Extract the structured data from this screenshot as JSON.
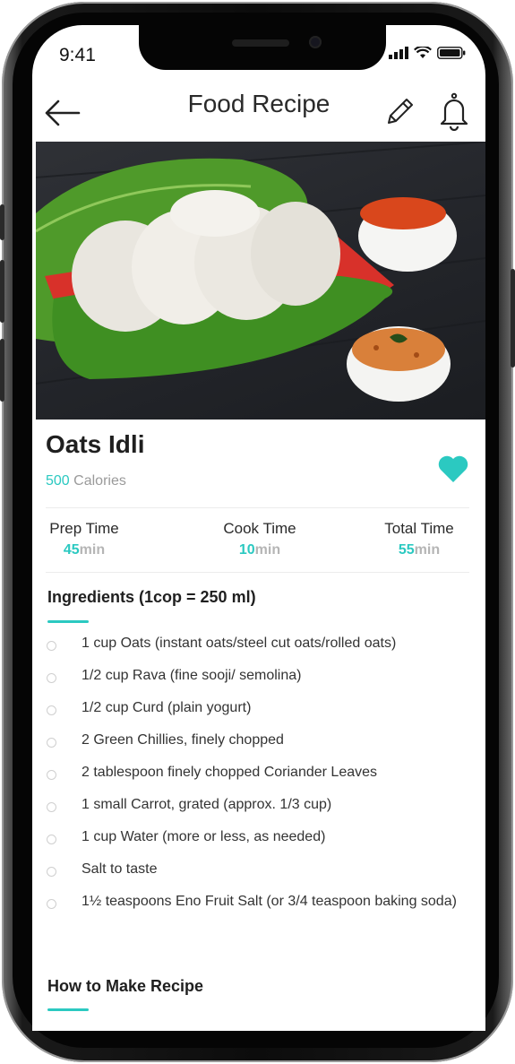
{
  "status_bar": {
    "time": "9:41"
  },
  "header": {
    "title": "Food Recipe"
  },
  "recipe": {
    "name": "Oats Idli",
    "calories_value": "500",
    "calories_unit": "Calories",
    "favorited": true
  },
  "times": [
    {
      "label": "Prep Time",
      "value": "45",
      "unit": "min"
    },
    {
      "label": "Cook Time",
      "value": "10",
      "unit": "min"
    },
    {
      "label": "Total Time",
      "value": "55",
      "unit": "min"
    }
  ],
  "ingredients": {
    "title": "Ingredients (1cop = 250 ml)",
    "items": [
      "1 cup Oats (instant oats/steel cut oats/rolled oats)",
      "1/2 cup Rava (fine sooji/ semolina)",
      "1/2 cup Curd (plain yogurt)",
      "2 Green Chillies, finely chopped",
      "2 tablespoon finely chopped Coriander Leaves",
      "1 small Carrot, grated (approx. 1/3 cup)",
      "1 cup Water (more or less, as needed)",
      "Salt to taste",
      "1½ teaspoons Eno Fruit Salt (or 3/4 teaspoon baking soda)"
    ]
  },
  "how_to": {
    "title": "How to Make Recipe"
  },
  "colors": {
    "accent": "#2bc9c1",
    "muted": "#9a9a9a"
  }
}
